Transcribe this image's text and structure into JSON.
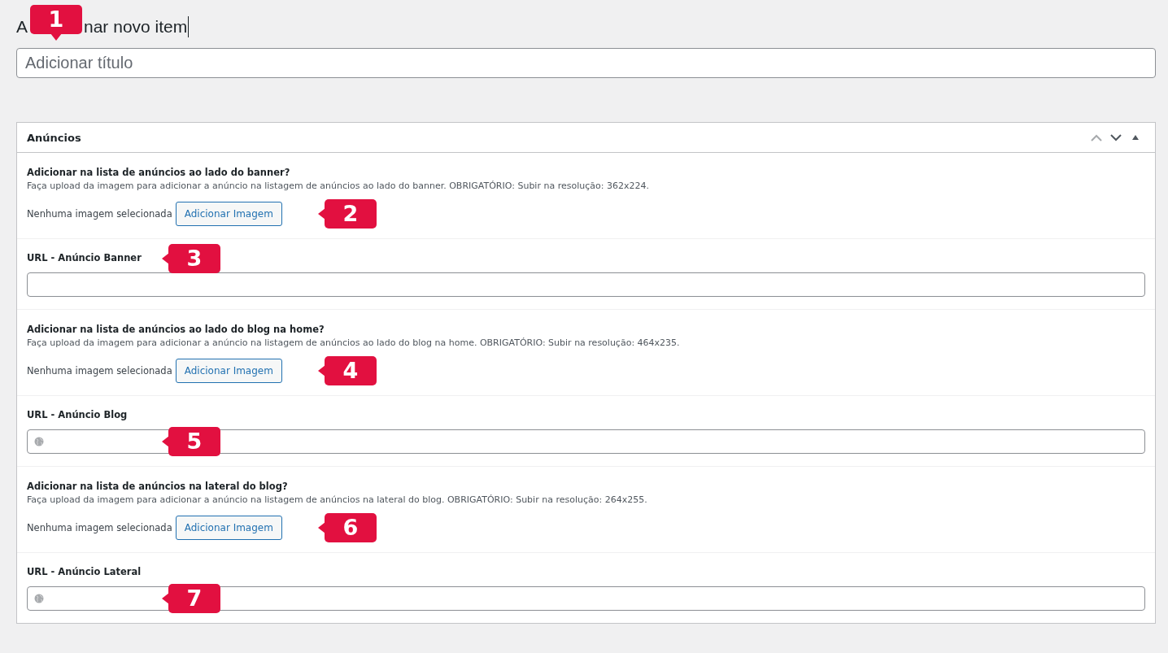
{
  "heading": {
    "parts": [
      "A",
      "nar novo item"
    ],
    "callout": "1"
  },
  "title_field": {
    "placeholder": "Adicionar título"
  },
  "panel": {
    "title": "Anúncios",
    "controls": [
      {
        "kind": "up",
        "disabled": true
      },
      {
        "kind": "down",
        "disabled": false
      },
      {
        "kind": "toggle",
        "disabled": false
      }
    ],
    "sections": [
      {
        "kind": "image",
        "label": "Adicionar na lista de anúncios ao lado do banner?",
        "description": "Faça upload da imagem para adicionar a anúncio na listagem de anúncios ao lado do banner. OBRIGATÓRIO: Subir na resolução: 362x224.",
        "status": "Nenhuma imagem selecionada",
        "button": "Adicionar Imagem",
        "callout": "2"
      },
      {
        "kind": "url",
        "label": "URL - Anúncio Banner",
        "globe": false,
        "callout": "3"
      },
      {
        "kind": "image",
        "label": "Adicionar na lista de anúncios ao lado do blog na home?",
        "description": "Faça upload da imagem para adicionar a anúncio na listagem de anúncios ao lado do blog na home. OBRIGATÓRIO: Subir na resolução: 464x235.",
        "status": "Nenhuma imagem selecionada",
        "button": "Adicionar Imagem",
        "callout": "4"
      },
      {
        "kind": "url",
        "label": "URL - Anúncio Blog",
        "globe": true,
        "callout": "5"
      },
      {
        "kind": "image",
        "label": "Adicionar na lista de anúncios na lateral do blog?",
        "description": "Faça upload da imagem para adicionar a anúncio na listagem de anúncios na lateral do blog. OBRIGATÓRIO: Subir na resolução: 264x255.",
        "status": "Nenhuma imagem selecionada",
        "button": "Adicionar Imagem",
        "callout": "6"
      },
      {
        "kind": "url",
        "label": "URL - Anúncio Lateral",
        "globe": true,
        "callout": "7"
      }
    ]
  }
}
